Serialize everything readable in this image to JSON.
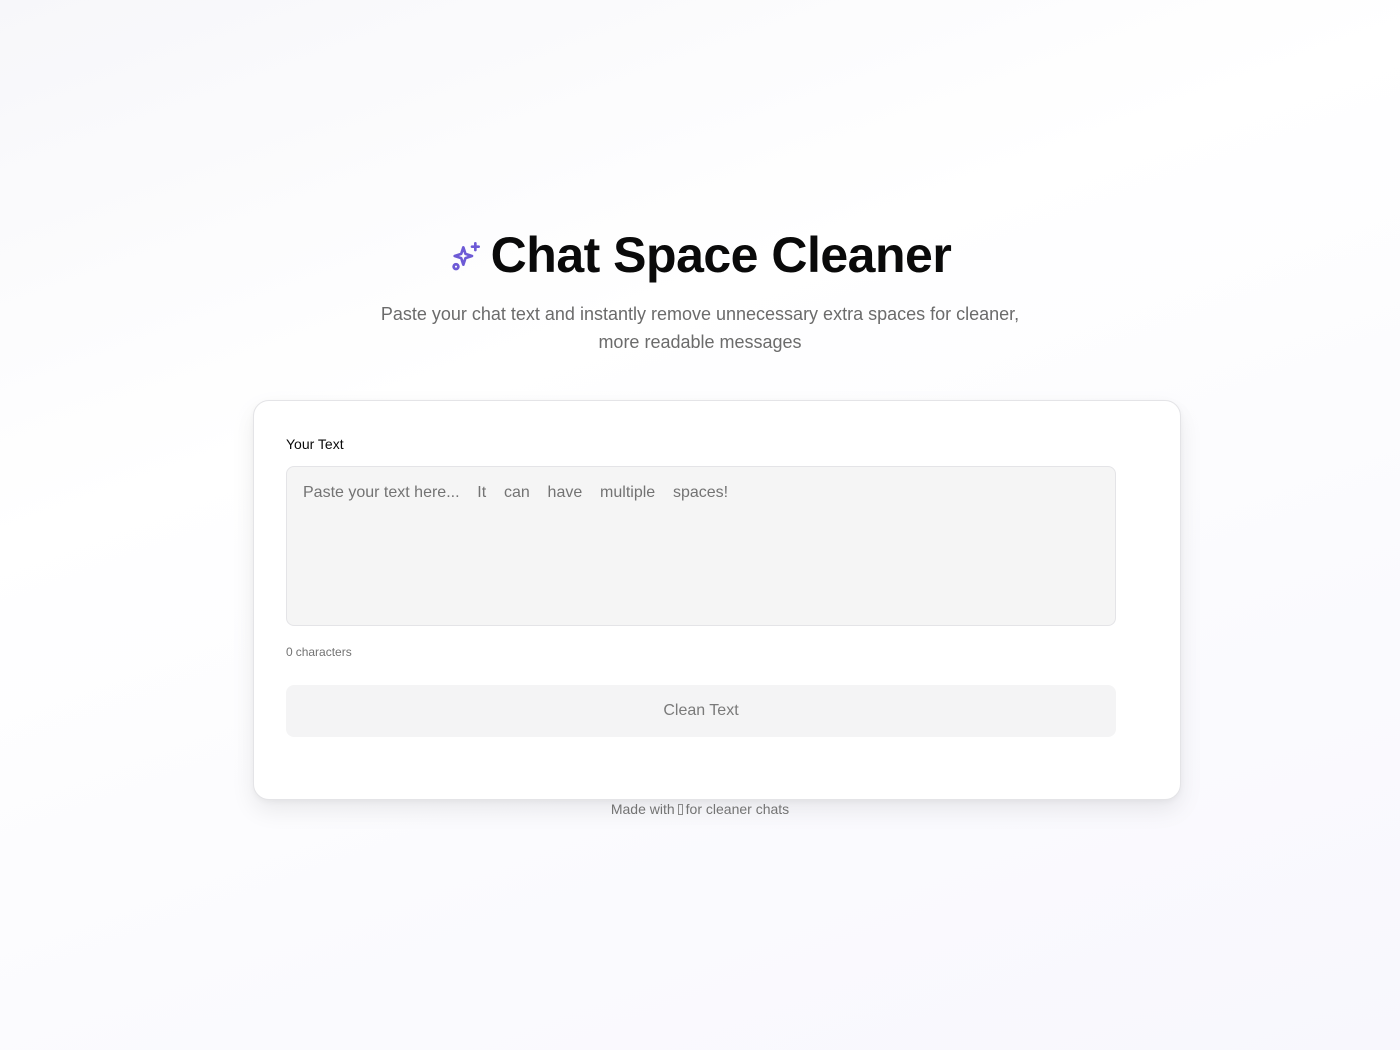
{
  "header": {
    "title": "Chat Space Cleaner",
    "subtitle": "Paste your chat text and instantly remove unnecessary extra spaces for cleaner, more readable messages",
    "icon": "sparkles-icon",
    "accent_color": "#6d5ad6"
  },
  "form": {
    "label": "Your Text",
    "placeholder": "Paste your text here...    It    can    have    multiple    spaces!",
    "value": "",
    "char_count": "0",
    "char_count_label": "characters",
    "button_label": "Clean Text"
  },
  "footer": {
    "prefix": "Made with",
    "icon": "heart-icon",
    "suffix": "for cleaner chats"
  }
}
